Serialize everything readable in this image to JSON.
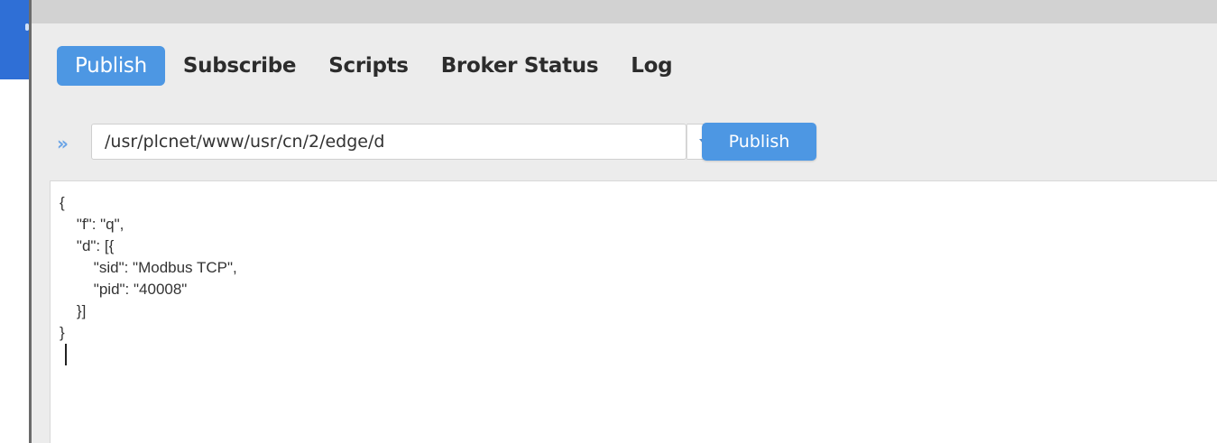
{
  "tabs": [
    {
      "label": "Publish",
      "active": true
    },
    {
      "label": "Subscribe",
      "active": false
    },
    {
      "label": "Scripts",
      "active": false
    },
    {
      "label": "Broker Status",
      "active": false
    },
    {
      "label": "Log",
      "active": false
    }
  ],
  "toolbar": {
    "chevron": "»",
    "topic_value": "/usr/plcnet/www/usr/cn/2/edge/d",
    "dropdown_icon": "chevron-down-icon",
    "publish_label": "Publish"
  },
  "editor": {
    "content": "{\n\t\"f\": \"q\",\n\t\"d\": [{\n\t\t\"sid\": \"Modbus TCP\",\n\t\t\"pid\": \"40008\"\n\t}]\n}"
  },
  "colors": {
    "accent": "#4d97e3",
    "app_bg": "#ececec",
    "editor_bg": "#ffffff"
  }
}
